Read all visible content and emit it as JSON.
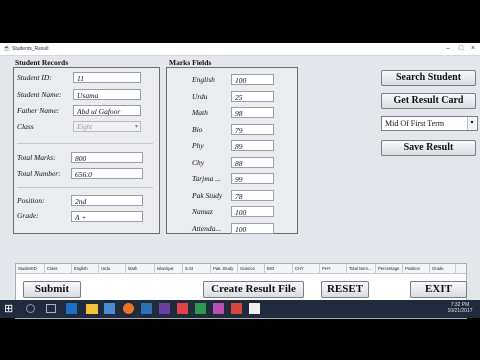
{
  "window": {
    "title": "Students_Result",
    "min": "–",
    "max": "□",
    "close": "×"
  },
  "student_records": {
    "title": "Student Records",
    "student_id": {
      "label": "Student ID:",
      "value": "11"
    },
    "student_name": {
      "label": "Student Name:",
      "value": "Usama"
    },
    "father_name": {
      "label": "Father Name:",
      "value": "Abd ul Gafoor"
    },
    "class": {
      "label": "Class",
      "value": "Eight"
    },
    "total_marks": {
      "label": "Total Marks:",
      "value": "800"
    },
    "total_number": {
      "label": "Total Number:",
      "value": "656.0"
    },
    "position": {
      "label": "Position:",
      "value": "2nd"
    },
    "grade": {
      "label": "Grade:",
      "value": "A +"
    }
  },
  "marks_fields": {
    "title": "Marks Fields",
    "items": [
      {
        "label": "English",
        "value": "100"
      },
      {
        "label": "Urdu",
        "value": "25"
      },
      {
        "label": "Math",
        "value": "98"
      },
      {
        "label": "Bio",
        "value": "79"
      },
      {
        "label": "Phy",
        "value": "89"
      },
      {
        "label": "Chy",
        "value": "88"
      },
      {
        "label": "Tarjma ...",
        "value": "99"
      },
      {
        "label": "Pak Study",
        "value": "78"
      },
      {
        "label": "Namaz",
        "value": "100"
      },
      {
        "label": "Attenda...",
        "value": "100"
      }
    ]
  },
  "actions": {
    "search_student": "Search Student",
    "get_result_card": "Get Result Card",
    "term_select": "Mid Of First Term",
    "save_result": "Save Result",
    "submit": "Submit",
    "create_result_file": "Create Result File",
    "reset": "RESET",
    "exit": "EXIT"
  },
  "table": {
    "columns": [
      "StudentID",
      "Class",
      "English",
      "Urdu",
      "Math",
      "Islamiyat",
      "S.St",
      "Pak. Study",
      "Science",
      "BIO",
      "CHY",
      "PHY",
      "Total Num...",
      "Percentage",
      "Position",
      "Grade"
    ]
  },
  "taskbar": {
    "time": "7:32 PM",
    "date": "10/21/2017"
  }
}
